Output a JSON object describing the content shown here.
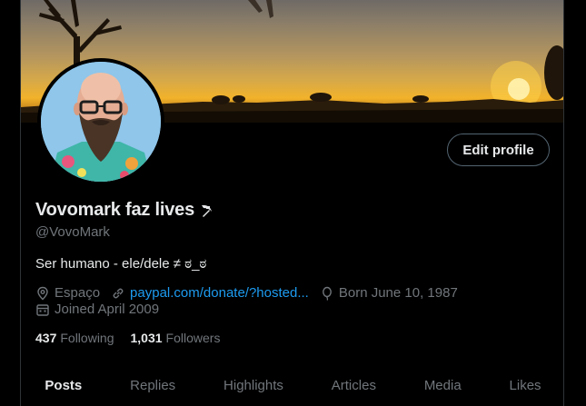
{
  "profile": {
    "display_name": "Vovomark faz lives",
    "handle": "@VovoMark",
    "bio": "Ser humano - ele/dele ≠ ಠ_ಠ",
    "edit_label": "Edit profile"
  },
  "meta": {
    "location": "Espaço",
    "website": "paypal.com/donate/?hosted...",
    "birthday": "Born June 10, 1987",
    "joined": "Joined April 2009"
  },
  "stats": {
    "following_count": "437",
    "following_label": "Following",
    "followers_count": "1,031",
    "followers_label": "Followers"
  },
  "tabs": [
    "Posts",
    "Replies",
    "Highlights",
    "Articles",
    "Media",
    "Likes"
  ],
  "active_tab": "Posts",
  "icons": {
    "name_emoji": "hammer-sickle-icon",
    "location": "location-pin-icon",
    "website": "link-icon",
    "birthday": "balloon-icon",
    "joined": "calendar-icon"
  },
  "colors": {
    "background": "#000000",
    "text": "#e7e9ea",
    "secondary": "#71767b",
    "link": "#1d9bf0",
    "border": "#2f3336"
  }
}
